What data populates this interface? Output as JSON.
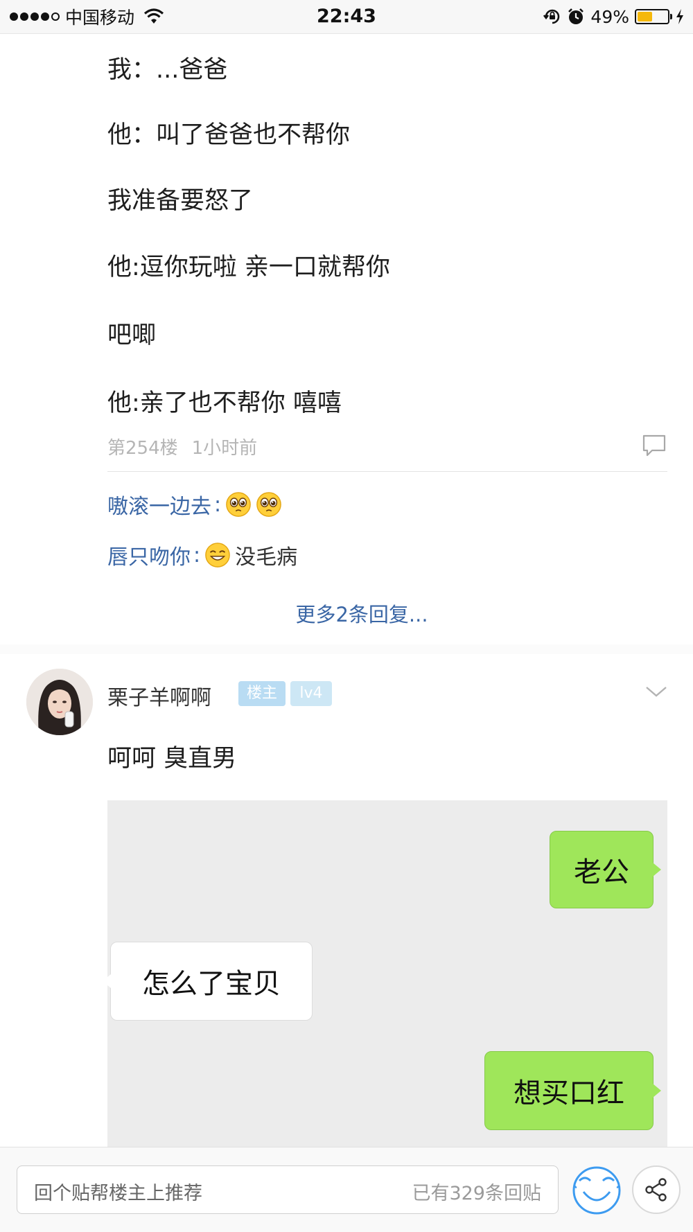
{
  "status_bar": {
    "carrier": "中国移动",
    "time": "22:43",
    "battery": "49%",
    "battery_level": 0.49,
    "icons": [
      "signal-icon",
      "wifi-icon",
      "rotation-lock-icon",
      "alarm-icon",
      "battery-icon",
      "charging-icon"
    ]
  },
  "post": {
    "lines": [
      "我：...爸爸",
      "他：叫了爸爸也不帮你",
      "我准备要怒了",
      "他:逗你玩啦 亲一口就帮你",
      "吧唧",
      "他:亲了也不帮你 嘻嘻"
    ],
    "floor": "第254楼",
    "time_ago": "1小时前"
  },
  "replies": [
    {
      "user": "嗷滚一边去",
      "sep": ":",
      "text": ""
    },
    {
      "user": "唇只吻你",
      "sep": ":",
      "text": "没毛病"
    }
  ],
  "more_replies": "更多2条回复...",
  "next_floor": {
    "username": "栗子羊啊啊",
    "badge_owner": "楼主",
    "badge_level": "lv4",
    "text": "呵呵 臭直男"
  },
  "chat_screenshot": {
    "messages": [
      {
        "side": "right",
        "text": "老公"
      },
      {
        "side": "left",
        "text": "怎么了宝贝"
      },
      {
        "side": "right",
        "text": "想买口红"
      }
    ]
  },
  "bottom_bar": {
    "placeholder": "回个贴帮楼主上推荐",
    "reply_count": "已有329条回贴"
  },
  "colors": {
    "link_blue": "#3a66a5",
    "chat_green": "#9fe65a",
    "battery_yellow": "#f5b80a"
  }
}
